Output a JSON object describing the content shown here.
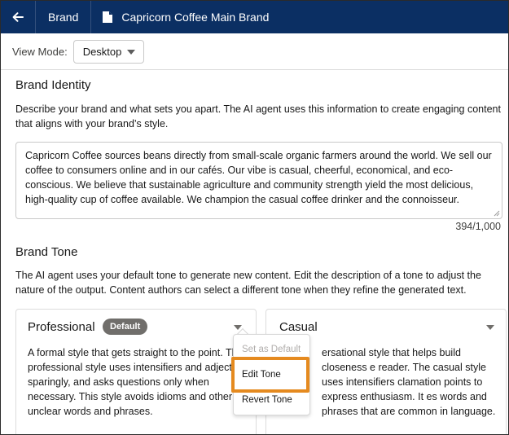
{
  "header": {
    "crumb": "Brand",
    "title": "Capricorn Coffee Main Brand"
  },
  "view_mode": {
    "label": "View Mode:",
    "selected": "Desktop"
  },
  "brand_identity": {
    "title": "Brand Identity",
    "description": "Describe your brand and what sets you apart. The AI agent uses this information to create engaging content that aligns with your brand’s style.",
    "text": "Capricorn Coffee sources beans directly from small-scale organic farmers around the world. We sell our coffee to consumers online and in our cafés. Our vibe is casual, cheerful, economical, and eco-conscious. We believe that sustainable agriculture and community strength yield the most delicious, high-quality cup of coffee available. We champion the casual coffee drinker and the connoisseur.",
    "counter": "394/1,000"
  },
  "brand_tone": {
    "title": "Brand Tone",
    "description": "The AI agent uses your default tone to generate new content. Edit the description of a tone to adjust the nature of the output. Content authors can select a different tone when they refine the generated text.",
    "tones": [
      {
        "name": "Professional",
        "badge": "Default",
        "text": "A formal style that gets straight to the point. Th professional style uses intensifiers and adjectiv sparingly, and asks questions only when necessary. This style avoids idioms and other unclear words and phrases."
      },
      {
        "name": "Casual",
        "text": "ersational style that helps build closeness e reader. The casual style uses intensifiers clamation points to express enthusiasm. It es words and phrases that are common in language."
      }
    ]
  },
  "menu": {
    "items": [
      "Set as Default",
      "Edit Tone",
      "Revert Tone"
    ]
  },
  "colors": {
    "header_bg": "#0b2f63",
    "highlight": "#e58a1f",
    "badge_bg": "#706e6b"
  }
}
